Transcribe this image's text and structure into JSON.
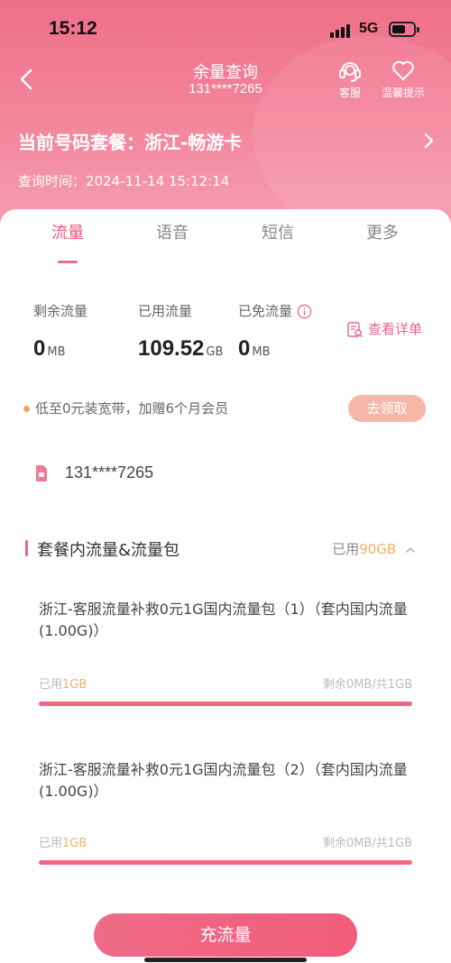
{
  "status_bar": {
    "time": "15:12",
    "network": "5G"
  },
  "nav": {
    "title": "余量查询",
    "subtitle": "131****7265",
    "service_label": "客服",
    "tips_label": "温馨提示"
  },
  "plan": {
    "label": "当前号码套餐：浙江-畅游卡",
    "query_time": "查询时间：2024-11-14 15:12:14"
  },
  "tabs": [
    {
      "label": "流量",
      "active": true
    },
    {
      "label": "语音",
      "active": false
    },
    {
      "label": "短信",
      "active": false
    },
    {
      "label": "更多",
      "active": false
    }
  ],
  "stats": {
    "remaining": {
      "label": "剩余流量",
      "value": "0",
      "unit": "MB"
    },
    "used": {
      "label": "已用流量",
      "value": "109.52",
      "unit": "GB"
    },
    "free": {
      "label": "已免流量",
      "value": "0",
      "unit": "MB"
    },
    "detail_link": "查看详单"
  },
  "promo": {
    "text": "低至0元装宽带，加赠6个月会员",
    "button": "去领取"
  },
  "phone": "131****7265",
  "section": {
    "title": "套餐内流量&流量包",
    "used_prefix": "已用",
    "used_amount": "90GB"
  },
  "packages": [
    {
      "name": "浙江-客服流量补救0元1G国内流量包（1）（套内国内流量(1.00G)）",
      "used_prefix": "已用",
      "used_amount": "1GB",
      "remaining": "剩余0MB/共1GB",
      "progress": 1.0
    },
    {
      "name": "浙江-客服流量补救0元1G国内流量包（2）（套内国内流量(1.00G)）",
      "used_prefix": "已用",
      "used_amount": "1GB",
      "remaining": "剩余0MB/共1GB",
      "progress": 1.0
    }
  ],
  "recharge_button": "充流量",
  "colors": {
    "accent": "#e8658a",
    "header": "#f06f8a",
    "used_amount": "#f0b06a"
  }
}
